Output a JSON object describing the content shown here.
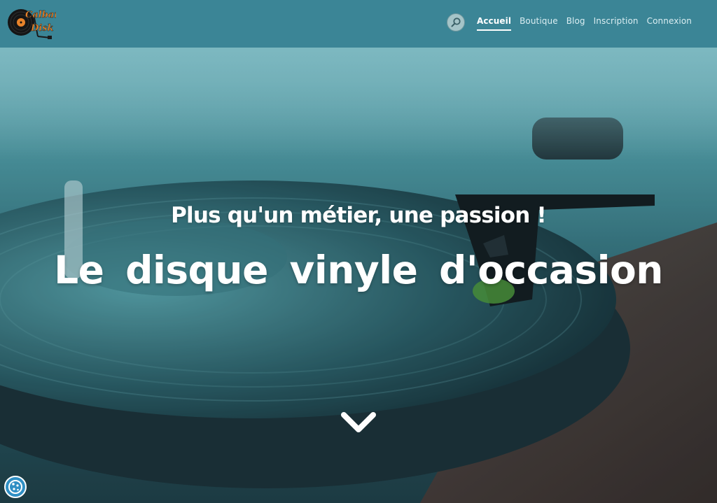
{
  "brand": {
    "logo_line1": "Calbar'",
    "logo_line2": "Disk"
  },
  "nav": {
    "search_icon": "search-icon",
    "items": [
      {
        "label": "Accueil",
        "active": true
      },
      {
        "label": "Boutique",
        "active": false
      },
      {
        "label": "Blog",
        "active": false
      },
      {
        "label": "Inscription",
        "active": false
      },
      {
        "label": "Connexion",
        "active": false
      }
    ]
  },
  "hero": {
    "subtitle": "Plus qu'un métier, une passion !",
    "title": "Le disque vinyle d'occasion",
    "scroll_icon": "chevron-down-icon"
  },
  "cookie": {
    "icon": "cookie-icon"
  },
  "colors": {
    "header_bg": "#3b8596",
    "logo_text": "#e8832a",
    "text_white": "#ffffff"
  }
}
